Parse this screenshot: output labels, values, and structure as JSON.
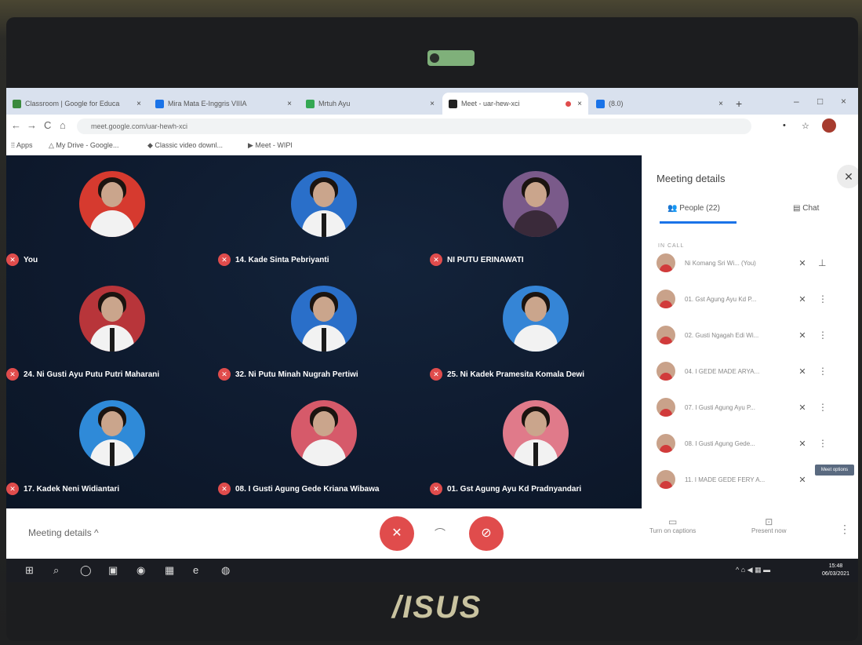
{
  "browser": {
    "tabs": [
      {
        "title": "Classroom | Google for Educa",
        "icon_color": "#3b8a3e",
        "active": false
      },
      {
        "title": "Mira Mata E-Inggris VIIIA",
        "icon_color": "#1a73e8",
        "active": false
      },
      {
        "title": "Mrtuh Ayu",
        "icon_color": "#34a853",
        "active": false
      },
      {
        "title": "Meet - uar-hew-xci",
        "icon_color": "#222222",
        "active": true
      },
      {
        "title": "(8.0)",
        "icon_color": "#1a73e8",
        "active": false
      }
    ],
    "tab_close_glyph": "×",
    "newtab_glyph": "+",
    "window_controls": [
      "–",
      "□",
      "×"
    ],
    "nav": {
      "back": "←",
      "forward": "→",
      "reload": "C",
      "home": "⌂"
    },
    "address": "meet.google.com/uar-hewh-xci",
    "address_icons": [
      "•",
      "☆"
    ],
    "bookmarks": [
      {
        "label": "Apps",
        "icon": "apps-grid-icon"
      },
      {
        "label": "My Drive - Google...",
        "icon": "drive-icon"
      },
      {
        "label": "Classic video downl...",
        "icon": "extension-icon"
      },
      {
        "label": "Meet - WIPI",
        "icon": "meet-icon"
      }
    ]
  },
  "participants": [
    {
      "name": "You",
      "bg": "#d63a2f"
    },
    {
      "name": "14. Kade Sinta Pebriyanti",
      "bg": "#2a6fc9"
    },
    {
      "name": "NI PUTU ERINAWATI",
      "bg": "#7a5a8a"
    },
    {
      "name": "24. Ni Gusti Ayu Putu Putri Maharani",
      "bg": "#b8353a"
    },
    {
      "name": "32. Ni Putu Minah Nugrah Pertiwi",
      "bg": "#2a6fc9"
    },
    {
      "name": "25. Ni Kadek Pramesita Komala Dewi",
      "bg": "#3585d6"
    },
    {
      "name": "17. Kadek Neni Widiantari",
      "bg": "#2f8ad8"
    },
    {
      "name": "08. I Gusti Agung Gede Kriana Wibawa",
      "bg": "#d65a6a"
    },
    {
      "name": "01. Gst Agung Ayu Kd Pradnyandari",
      "bg": "#e07a8a"
    }
  ],
  "mic_muted_glyph": "✕",
  "panel": {
    "title": "Meeting details",
    "close": "✕",
    "tabs": [
      {
        "label": "People (22)",
        "icon": "👥"
      },
      {
        "label": "Chat",
        "icon": "▤"
      }
    ],
    "section_label": "IN CALL",
    "people": [
      {
        "name": "Ni Komang Sri Wi... (You)",
        "action": "⊥"
      },
      {
        "name": "01. Gst Agung Ayu Kd P...",
        "action": "⋮"
      },
      {
        "name": "02. Gusti Ngagah Edi Wi...",
        "action": "⋮"
      },
      {
        "name": "04. I GEDE MADE ARYA...",
        "action": "⋮"
      },
      {
        "name": "07. I Gusti Agung Ayu P...",
        "action": "⋮"
      },
      {
        "name": "08. I Gusti Agung Gede...",
        "action": "⋮"
      },
      {
        "name": "11. I MADE GEDE FERY A...",
        "action": ""
      }
    ],
    "mic_glyph": "✕",
    "tooltip": "Meet options"
  },
  "bottom": {
    "meeting_details": "Meeting details  ^",
    "mic_glyph": "✕",
    "hangup_glyph": "⌒",
    "camera_glyph": "⊘",
    "captions_label": "Turn on captions",
    "present_label": "Present now",
    "captions_icon": "▭",
    "present_icon": "⊡",
    "more_glyph": "⋮"
  },
  "taskbar": {
    "icons": [
      "⊞",
      "⌕",
      "◯",
      "▣",
      "◉",
      "▦",
      "e",
      "◍"
    ],
    "tray": "^ ⌂ ◀ ▦ ▬",
    "time": "15:48",
    "date": "06/03/2021"
  },
  "laptop_brand": "/ISUS"
}
